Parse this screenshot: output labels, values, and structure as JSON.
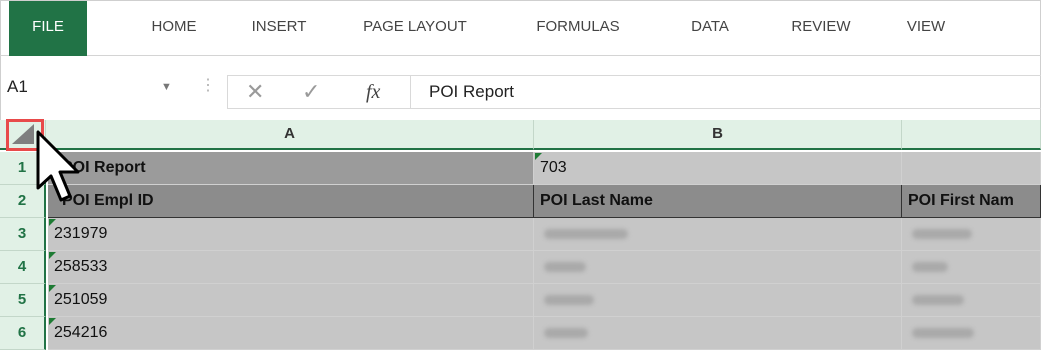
{
  "ribbon": {
    "tabs": [
      "FILE",
      "HOME",
      "INSERT",
      "PAGE LAYOUT",
      "FORMULAS",
      "DATA",
      "REVIEW",
      "VIEW"
    ],
    "active": "FILE"
  },
  "formula_bar": {
    "name_box": "A1",
    "formula": "POI Report",
    "fx_label": "fx"
  },
  "grid": {
    "columns": [
      "A",
      "B"
    ],
    "rows": [
      "1",
      "2",
      "3",
      "4",
      "5",
      "6"
    ],
    "row1": {
      "a": "POI Report",
      "b": "703"
    },
    "row2": {
      "a": "POI Empl ID",
      "b": "POI Last Name",
      "c": "POI First Nam"
    },
    "employee_ids": [
      "231979",
      "258533",
      "251059",
      "254216"
    ]
  },
  "colors": {
    "accent": "#217346",
    "header_fill": "#e1f1e6",
    "highlight_box": "#e84a4a"
  }
}
